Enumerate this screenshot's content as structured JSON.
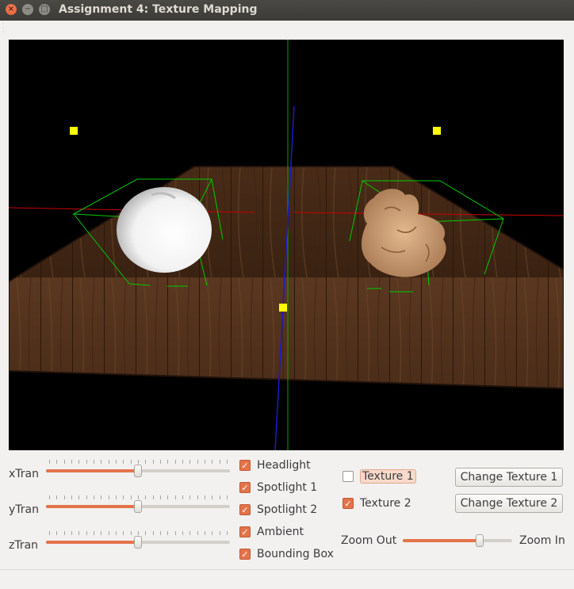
{
  "window": {
    "title": "Assignment 4: Texture Mapping",
    "buttons": {
      "close": "×",
      "minimize": "−",
      "maximize": "□"
    }
  },
  "viewport": {
    "background": "#000000",
    "objects": [
      "apple-model",
      "dragon-model",
      "wood-table"
    ],
    "light_marker_color": "#ffff00",
    "bbox_color": "#00cc00"
  },
  "sliders": {
    "xTran": {
      "label": "xTran",
      "value_fraction": 0.5
    },
    "yTran": {
      "label": "yTran",
      "value_fraction": 0.5
    },
    "zTran": {
      "label": "zTran",
      "value_fraction": 0.5
    }
  },
  "lights": [
    {
      "label": "Headlight",
      "checked": true
    },
    {
      "label": "Spotlight 1",
      "checked": true
    },
    {
      "label": "Spotlight 2",
      "checked": true
    },
    {
      "label": "Ambient",
      "checked": true
    },
    {
      "label": "Bounding Box",
      "checked": true
    }
  ],
  "textures": {
    "texture1": {
      "label": "Texture 1",
      "checked": false
    },
    "texture2": {
      "label": "Texture 2",
      "checked": true
    }
  },
  "buttons": {
    "change_texture_1": "Change Texture 1",
    "change_texture_2": "Change Texture 2"
  },
  "zoom": {
    "out_label": "Zoom Out",
    "in_label": "Zoom In",
    "value_fraction": 0.7
  },
  "colors": {
    "accent": "#e4734a",
    "titlebar": "#3c3b37",
    "window_bg": "#f2f1f0"
  }
}
